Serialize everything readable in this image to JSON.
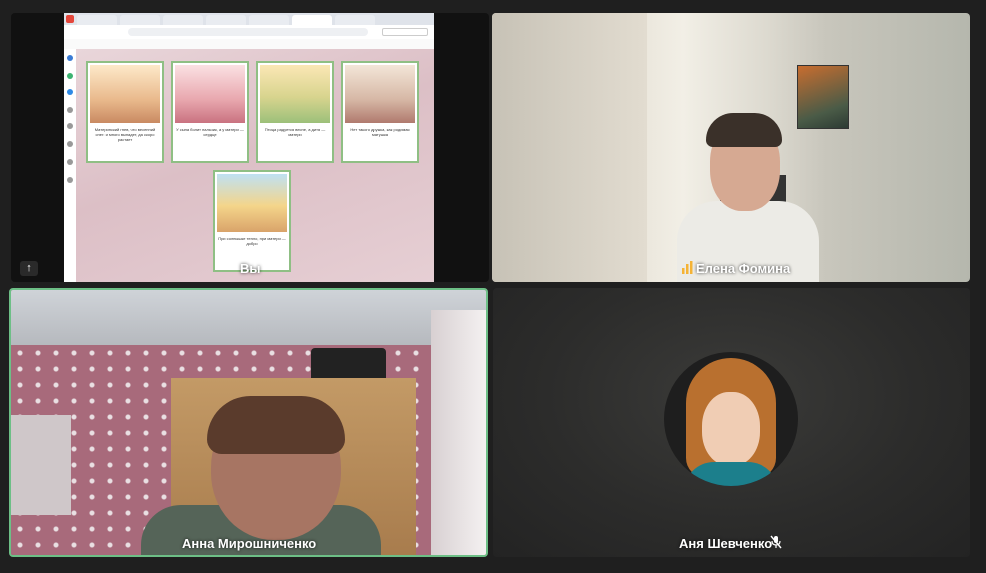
{
  "participants": {
    "self": {
      "name": "Вы"
    },
    "elena": {
      "name": "Елена Фомина",
      "speaking_icon": "audio-level-icon"
    },
    "anna_m": {
      "name": "Анна Мирошниченко"
    },
    "anya_sh": {
      "name": "Аня Шевченко",
      "muted_icon": "mic-off-icon"
    }
  },
  "shared_screen": {
    "cards": [
      {
        "caption": "Материнский гнев, что весенний снег: и много выпадет, да скоро растает"
      },
      {
        "caption": "У сына болит пальчик, а у матери — сердце"
      },
      {
        "caption": "Птица радуется весне, а дитя — матери"
      },
      {
        "caption": "Нет такого дружка, как родимая матушка"
      },
      {
        "caption": "При солнышке тепло, при матери — добро"
      }
    ]
  },
  "colors": {
    "active_speaker_border": "#6dbf86",
    "card_border": "#8fbf84"
  }
}
